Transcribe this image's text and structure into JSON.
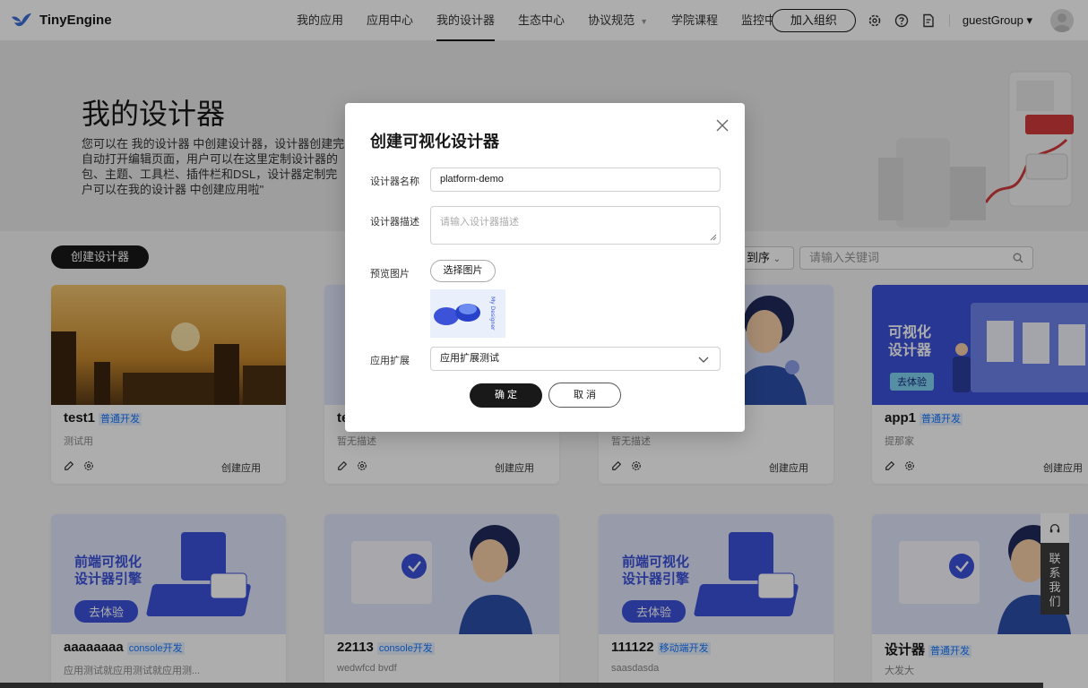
{
  "header": {
    "logo_text": "TinyEngine",
    "nav": [
      {
        "label": "我的应用"
      },
      {
        "label": "应用中心"
      },
      {
        "label": "我的设计器",
        "active": true
      },
      {
        "label": "生态中心"
      },
      {
        "label": "协议规范",
        "caret": "▼"
      },
      {
        "label": "学院课程"
      },
      {
        "label": "监控中心"
      }
    ],
    "join_label": "加入组织",
    "user_label": "guestGroup",
    "user_caret": "▾",
    "icons": [
      "gear-icon",
      "help-icon",
      "document-icon"
    ]
  },
  "hero": {
    "title": "我的设计器",
    "desc_lines": [
      "您可以在 我的设计器 中创建设计器，设计器创建完",
      "自动打开编辑页面，用户可以在这里定制设计器的",
      "包、主题、工具栏、插件栏和DSL，设计器定制完",
      "户可以在我的设计器 中创建应用啦\""
    ]
  },
  "toolbar": {
    "create_label": "创建设计器",
    "sort_label": "到序",
    "search_placeholder": "请输入关键词"
  },
  "cards": [
    {
      "title": "test1",
      "tag": "普通开发",
      "desc": "测试用",
      "create": "创建应用"
    },
    {
      "title": "te",
      "tag": "",
      "desc": "暂无描述",
      "create": "创建应用"
    },
    {
      "title": "",
      "tag": "",
      "desc": "暂无描述",
      "create": "创建应用"
    },
    {
      "title": "app1",
      "tag": "普通开发",
      "desc": "提那家",
      "create": "创建应用",
      "banner_text": [
        "可视化",
        "设计器"
      ],
      "banner_btn": "去体验"
    },
    {
      "title": "aaaaaaaa",
      "tag": "console开发",
      "desc": "应用测试就应用测试就应用测...",
      "banner_text": [
        "前端可视化",
        "设计器引擎"
      ],
      "banner_btn": "去体验"
    },
    {
      "title": "22113",
      "tag": "console开发",
      "desc": "wedwfcd bvdf"
    },
    {
      "title": "111122",
      "tag": "移动端开发",
      "desc": "saasdasda",
      "banner_text": [
        "前端可视化",
        "设计器引擎"
      ],
      "banner_btn": "去体验"
    },
    {
      "title": "设计器",
      "tag": "普通开发",
      "desc": "大发大"
    }
  ],
  "dialog": {
    "title": "创建可视化设计器",
    "name_label": "设计器名称",
    "name_value": "platform-demo",
    "desc_label": "设计器描述",
    "desc_placeholder": "请输入设计器描述",
    "preview_label": "预览图片",
    "pick_label": "选择图片",
    "preview_caption": "My Designer",
    "ext_label": "应用扩展",
    "ext_value": "应用扩展测试",
    "ok_label": "确 定",
    "cancel_label": "取 消"
  },
  "side": {
    "contact_chars": [
      "联",
      "系",
      "我",
      "们"
    ]
  },
  "colors": {
    "dark": "#191919",
    "tag_blue": "#1677ff",
    "banner_blue": "#3c52d9",
    "banner_light": "#dfe5fb",
    "city_sky": "#c98a2e"
  }
}
